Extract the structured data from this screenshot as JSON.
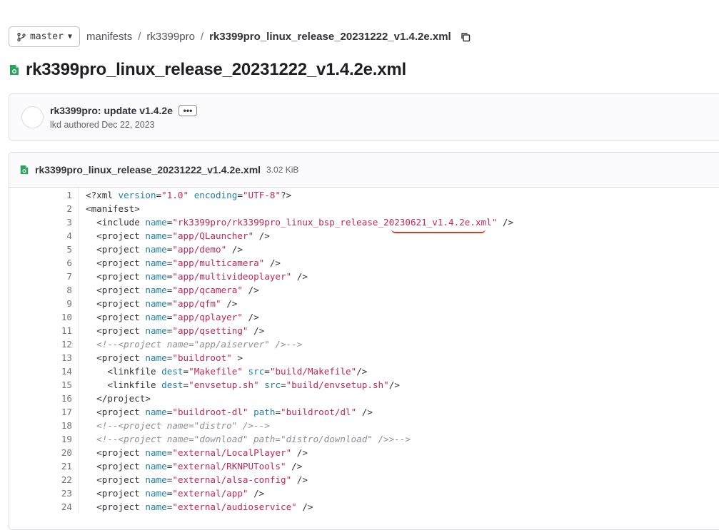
{
  "branch": {
    "label": "master"
  },
  "breadcrumbs": [
    "manifests",
    "rk3399pro",
    "rk3399pro_linux_release_20231222_v1.4.2e.xml"
  ],
  "title": "rk3399pro_linux_release_20231222_v1.4.2e.xml",
  "commit": {
    "message": "rk3399pro: update v1.4.2e",
    "ellipsis": "•••",
    "meta": "lkd authored Dec 22, 2023"
  },
  "file": {
    "name": "rk3399pro_linux_release_20231222_v1.4.2e.xml",
    "size": "3.02 KiB"
  },
  "colors": {
    "attr": "#1f7fa8",
    "value": "#c0265a",
    "comment": "#8f8f95",
    "annotation": "#d23a2a"
  },
  "code_lines": [
    {
      "n": "1",
      "text": "<?xml version=\"1.0\" encoding=\"UTF-8\"?>"
    },
    {
      "n": "2",
      "text": "<manifest>"
    },
    {
      "n": "3",
      "text": "  <include name=\"rk3399pro/rk3399pro_linux_bsp_release_20230621_v1.4.2e.xml\" />"
    },
    {
      "n": "4",
      "text": "  <project name=\"app/QLauncher\" />"
    },
    {
      "n": "5",
      "text": "  <project name=\"app/demo\" />"
    },
    {
      "n": "6",
      "text": "  <project name=\"app/multicamera\" />"
    },
    {
      "n": "7",
      "text": "  <project name=\"app/multivideoplayer\" />"
    },
    {
      "n": "8",
      "text": "  <project name=\"app/qcamera\" />"
    },
    {
      "n": "9",
      "text": "  <project name=\"app/qfm\" />"
    },
    {
      "n": "10",
      "text": "  <project name=\"app/qplayer\" />"
    },
    {
      "n": "11",
      "text": "  <project name=\"app/qsetting\" />"
    },
    {
      "n": "12",
      "text": "  <!--<project name=\"app/aiserver\" />-->"
    },
    {
      "n": "13",
      "text": "  <project name=\"buildroot\" >"
    },
    {
      "n": "14",
      "text": "    <linkfile dest=\"Makefile\" src=\"build/Makefile\"/>"
    },
    {
      "n": "15",
      "text": "    <linkfile dest=\"envsetup.sh\" src=\"build/envsetup.sh\"/>"
    },
    {
      "n": "16",
      "text": "  </project>"
    },
    {
      "n": "17",
      "text": "  <project name=\"buildroot-dl\" path=\"buildroot/dl\" />"
    },
    {
      "n": "18",
      "text": "  <!--<project name=\"distro\" />-->"
    },
    {
      "n": "19",
      "text": "  <!--<project name=\"download\" path=\"distro/download\" />>-->"
    },
    {
      "n": "20",
      "text": "  <project name=\"external/LocalPlayer\" />"
    },
    {
      "n": "21",
      "text": "  <project name=\"external/RKNPUTools\" />"
    },
    {
      "n": "22",
      "text": "  <project name=\"external/alsa-config\" />"
    },
    {
      "n": "23",
      "text": "  <project name=\"external/app\" />"
    },
    {
      "n": "24",
      "text": "  <project name=\"external/audioservice\" />"
    }
  ]
}
